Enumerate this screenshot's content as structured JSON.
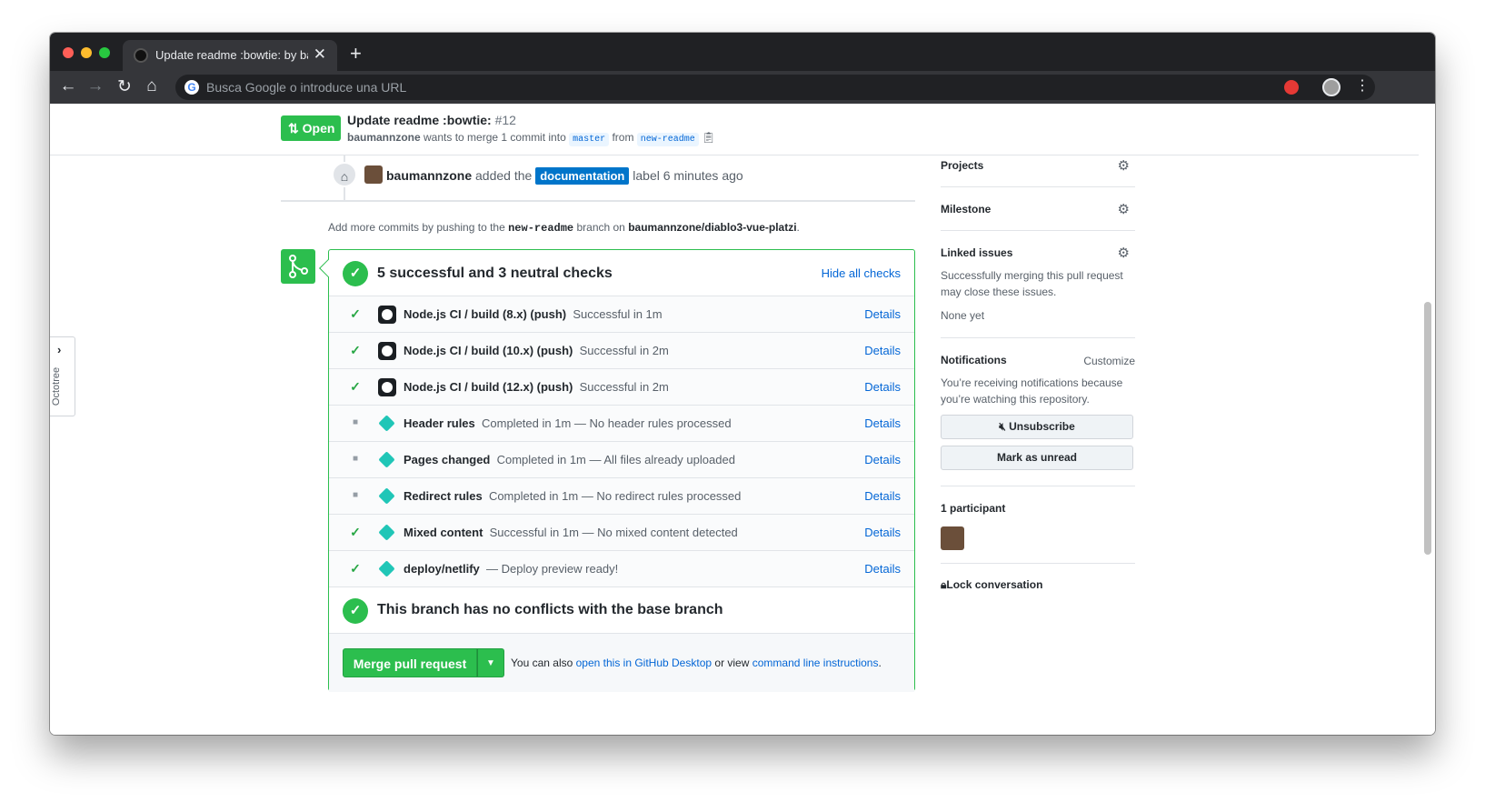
{
  "browser": {
    "tab_title": "Update readme :bowtie: by baumannzone",
    "new_tab": "+",
    "close": "✕",
    "omnibox_placeholder": "Busca Google o introduce una URL",
    "omnibox_icon": "G"
  },
  "pr": {
    "state": "Open",
    "title": "Update readme :bowtie:",
    "number": "#12",
    "author": "baumannzone",
    "merge_text": "wants to merge 1 commit into",
    "base_branch": "master",
    "from": "from",
    "head_branch": "new-readme"
  },
  "timeline": {
    "event_user": "baumannzone",
    "event_text": "added the",
    "label": "documentation",
    "event_suffix": "label 6 minutes ago",
    "hint_pre": "Add more commits by pushing to the",
    "hint_branch": "new-readme",
    "hint_mid": "branch on",
    "hint_repo": "baumannzone/diablo3-vue-platzi",
    "hint_end": "."
  },
  "checks": {
    "summary": "5 successful and 3 neutral checks",
    "hide_label": "Hide all checks",
    "details_label": "Details",
    "rows": [
      {
        "status": "success",
        "app": "github",
        "name": "Node.js CI / build (8.x) (push)",
        "desc": "Successful in 1m"
      },
      {
        "status": "success",
        "app": "github",
        "name": "Node.js CI / build (10.x) (push)",
        "desc": "Successful in 2m"
      },
      {
        "status": "success",
        "app": "github",
        "name": "Node.js CI / build (12.x) (push)",
        "desc": "Successful in 2m"
      },
      {
        "status": "neutral",
        "app": "netlify",
        "name": "Header rules",
        "desc": "Completed in 1m — No header rules processed"
      },
      {
        "status": "neutral",
        "app": "netlify",
        "name": "Pages changed",
        "desc": "Completed in 1m — All files already uploaded"
      },
      {
        "status": "neutral",
        "app": "netlify",
        "name": "Redirect rules",
        "desc": "Completed in 1m — No redirect rules processed"
      },
      {
        "status": "success",
        "app": "netlify",
        "name": "Mixed content",
        "desc": "Successful in 1m — No mixed content detected"
      },
      {
        "status": "success",
        "app": "netlify",
        "name": "deploy/netlify",
        "desc": "— Deploy preview ready!"
      }
    ],
    "no_conflicts": "This branch has no conflicts with the base branch"
  },
  "merge": {
    "button": "Merge pull request",
    "note_pre": "You can also",
    "desktop_link": "open this in GitHub Desktop",
    "note_mid": "or view",
    "cli_link": "command line instructions",
    "note_end": "."
  },
  "sidebar": {
    "projects": "Projects",
    "milestone": "Milestone",
    "linked_issues": "Linked issues",
    "linked_desc": "Successfully merging this pull request may close these issues.",
    "none_yet": "None yet",
    "notifications": "Notifications",
    "customize": "Customize",
    "notif_desc": "You’re receiving notifications because you’re watching this repository.",
    "unsubscribe": "Unsubscribe",
    "mark_unread": "Mark as unread",
    "participants": "1 participant",
    "lock": "Lock conversation"
  },
  "octotree": {
    "label": "Octotree"
  },
  "colors": {
    "green": "#2cbe4e",
    "link": "#0366d6",
    "label_documentation": "#0075ca",
    "chrome_dark": "#202124"
  }
}
